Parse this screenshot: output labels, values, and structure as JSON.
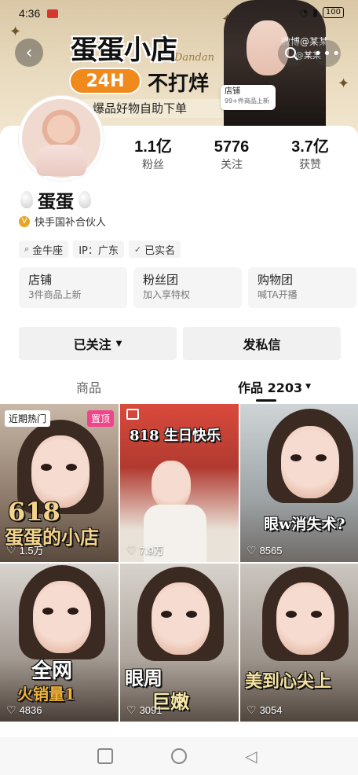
{
  "status_bar": {
    "time": "4:36",
    "battery": "100"
  },
  "header": {
    "banner_title": "蛋蛋小店",
    "banner_signature": "Dandan",
    "banner_pill": "24H",
    "banner_no_close": "不打烊",
    "banner_slogan": "爆品好物自助下单",
    "watermark_line1": "微博@某某",
    "watermark_line2": "@某某",
    "shop_tag_title": "店铺",
    "shop_tag_sub": "99+件商品上新"
  },
  "profile": {
    "stats": [
      {
        "value": "1.1亿",
        "label": "粉丝"
      },
      {
        "value": "5776",
        "label": "关注"
      },
      {
        "value": "3.7亿",
        "label": "获赞"
      }
    ],
    "nickname": "蛋蛋",
    "verified_label": "快手国补合伙人",
    "tags": [
      {
        "icon": "pin-icon",
        "glyph": "⌕",
        "label": "金牛座"
      },
      {
        "icon": "",
        "glyph": "",
        "label": "IP：广东"
      },
      {
        "icon": "shield-check-icon",
        "glyph": "✓",
        "label": "已实名"
      }
    ],
    "cards": [
      {
        "title": "店铺",
        "sub": "3件商品上新"
      },
      {
        "title": "粉丝团",
        "sub": "加入享特权"
      },
      {
        "title": "购物团",
        "sub": "喊TA开播"
      }
    ],
    "follow_button": "已关注",
    "message_button": "发私信"
  },
  "tabs": {
    "goods": "商品",
    "works": "作品 2203"
  },
  "videos": [
    {
      "badge_left": "近期热门",
      "badge_right": "置顶",
      "overlay": "618",
      "overlay2": "蛋蛋的小店",
      "likes": "1.5万"
    },
    {
      "overlay": "818 生日快乐",
      "likes": "7.9万"
    },
    {
      "overlay": "眼w消失术?",
      "likes": "8565"
    },
    {
      "overlay": "全网",
      "overlay2": "火销量1",
      "likes": "4836"
    },
    {
      "overlay": "眼周",
      "overlay2": "巨嫩",
      "likes": "3091"
    },
    {
      "overlay": "美到心尖上",
      "likes": "3054"
    }
  ],
  "colors": {
    "pin_badge": "#f0458a",
    "pill_orange": "#f08a1d",
    "verified_gold": "#e5a626"
  }
}
